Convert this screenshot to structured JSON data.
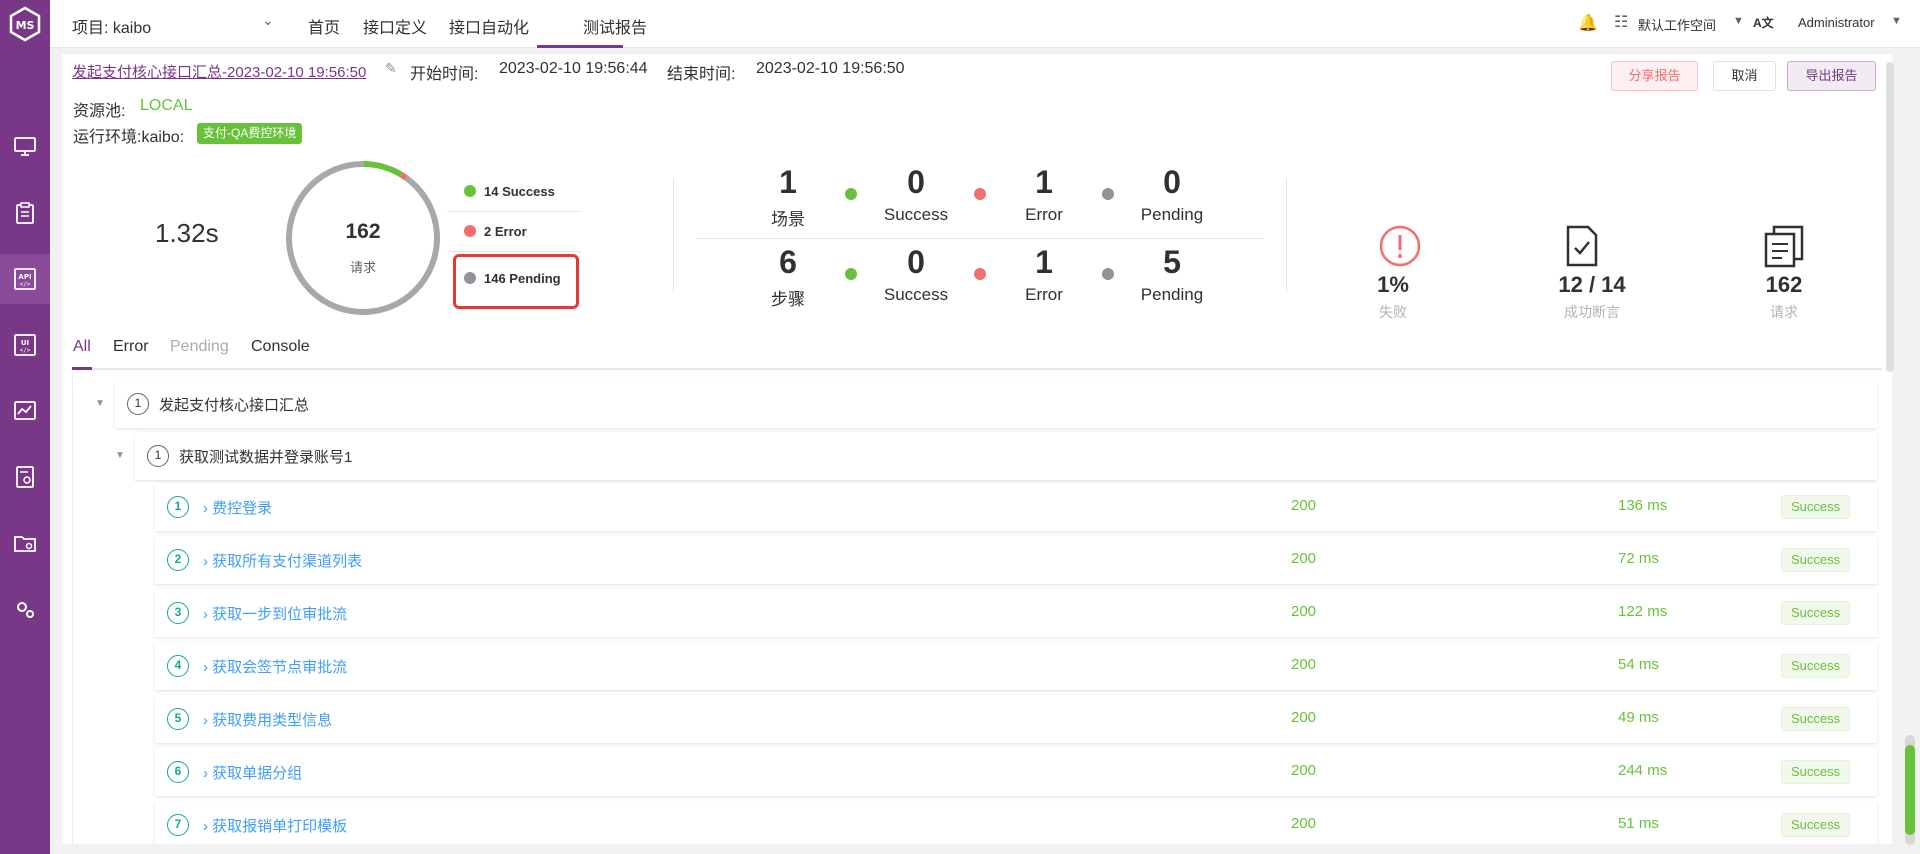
{
  "nav": {
    "project": "项目: kaibo",
    "items": [
      "首页",
      "接口定义",
      "接口自动化",
      "测试报告"
    ],
    "workspace": "默认工作空间",
    "user": "Administrator"
  },
  "report": {
    "name": "发起支付核心接口汇总-2023-02-10 19:56:50",
    "start_label": "开始时间:",
    "start_time": "2023-02-10 19:56:44",
    "end_label": "结束时间:",
    "end_time": "2023-02-10 19:56:50",
    "pool_label": "资源池:",
    "pool_value": "LOCAL",
    "env_label": "运行环境:kaibo:",
    "env_tag": "支付-QA费控环境"
  },
  "actions": {
    "share": "分享报告",
    "cancel": "取消",
    "export": "导出报告"
  },
  "summary": {
    "duration": "1.32s",
    "total": "162",
    "total_label": "请求",
    "legend": {
      "success": "14 Success",
      "error": "2 Error",
      "pending": "146 Pending"
    },
    "counts": {
      "success": 14,
      "error": 2,
      "pending": 146
    }
  },
  "stats": {
    "scenario": {
      "num": "1",
      "label": "场景",
      "success": "0",
      "error": "1",
      "pending": "0"
    },
    "step": {
      "num": "6",
      "label": "步骤",
      "success": "0",
      "error": "1",
      "pending": "5"
    },
    "success_label": "Success",
    "error_label": "Error",
    "pending_label": "Pending"
  },
  "kpis": [
    {
      "icon": "alert-circle-icon",
      "value": "1%",
      "label": "失败"
    },
    {
      "icon": "document-check-icon",
      "value": "12 / 14",
      "label": "成功断言"
    },
    {
      "icon": "documents-icon",
      "value": "162",
      "label": "请求"
    }
  ],
  "tabs": [
    "All",
    "Error",
    "Pending",
    "Console"
  ],
  "tree": {
    "scenario": {
      "index": "1",
      "title": "发起支付核心接口汇总"
    },
    "step": {
      "index": "1",
      "title": "获取测试数据并登录账号1"
    },
    "requests": [
      {
        "index": "1",
        "title": "费控登录",
        "code": "200",
        "time": "136 ms",
        "status": "Success"
      },
      {
        "index": "2",
        "title": "获取所有支付渠道列表",
        "code": "200",
        "time": "72 ms",
        "status": "Success"
      },
      {
        "index": "3",
        "title": "获取一步到位审批流",
        "code": "200",
        "time": "122 ms",
        "status": "Success"
      },
      {
        "index": "4",
        "title": "获取会签节点审批流",
        "code": "200",
        "time": "54 ms",
        "status": "Success"
      },
      {
        "index": "5",
        "title": "获取费用类型信息",
        "code": "200",
        "time": "49 ms",
        "status": "Success"
      },
      {
        "index": "6",
        "title": "获取单据分组",
        "code": "200",
        "time": "244 ms",
        "status": "Success"
      },
      {
        "index": "7",
        "title": "获取报销单打印模板",
        "code": "200",
        "time": "51 ms",
        "status": "Success"
      }
    ]
  },
  "colors": {
    "brand": "#783887",
    "success": "#67c23a",
    "error": "#f56c6c",
    "pending": "#909399",
    "link": "#409eff"
  }
}
